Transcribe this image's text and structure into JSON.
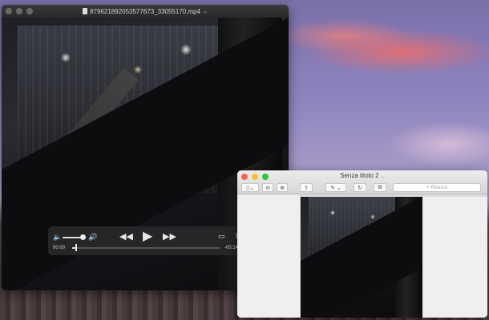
{
  "quicktime": {
    "title": "8796218920535776​73_330551​70.mp4",
    "time_elapsed": "00:00",
    "time_remaining": "-00:14",
    "progress_fraction": 0.02,
    "volume_fraction": 0.9
  },
  "preview": {
    "title": "Senza titolo 2",
    "search_placeholder": "Ricerca"
  },
  "icons": {
    "volume_low": "speaker-low",
    "volume_high": "speaker-high",
    "rewind": "rewind",
    "play": "play",
    "fast_forward": "fast-forward",
    "airplay": "airplay",
    "share": "share"
  }
}
